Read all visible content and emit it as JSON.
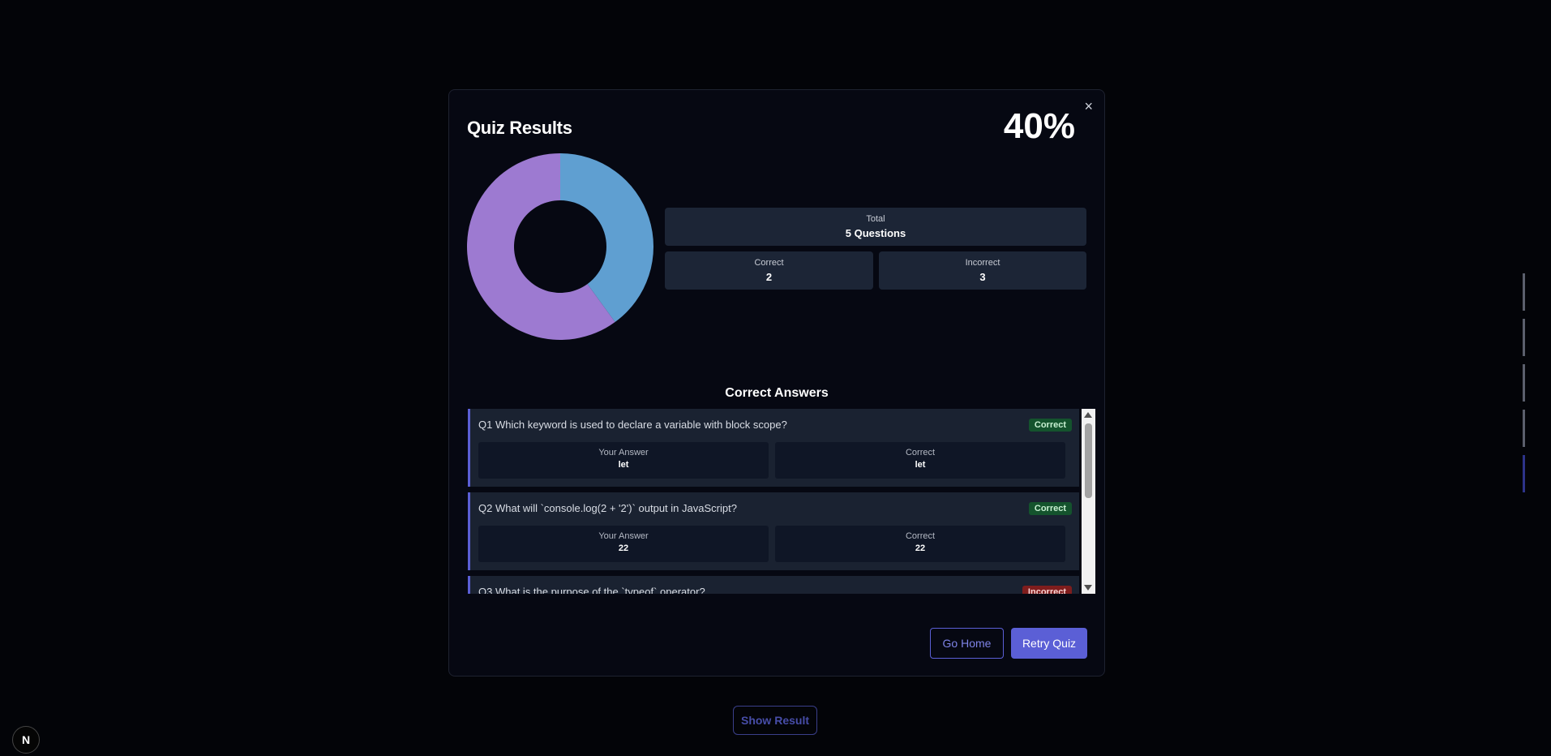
{
  "modal": {
    "title": "Quiz Results",
    "score": "40%",
    "close_glyph": "×"
  },
  "stats": {
    "total_label": "Total",
    "total_value": "5 Questions",
    "correct_label": "Correct",
    "correct_value": "2",
    "incorrect_label": "Incorrect",
    "incorrect_value": "3"
  },
  "chart_data": {
    "type": "pie",
    "slices": [
      {
        "value": 2,
        "color": "#5f9fd1"
      },
      {
        "value": 3,
        "color": "#9d7ad1"
      }
    ]
  },
  "answers": {
    "section_title": "Correct Answers",
    "your_answer_label": "Your Answer",
    "correct_label": "Correct",
    "items": [
      {
        "number": "Q1",
        "question": "Which keyword is used to declare a variable with block scope?",
        "status": "Correct",
        "your_answer": "let",
        "correct_answer": "let"
      },
      {
        "number": "Q2",
        "question": "What will `console.log(2 + '2')` output in JavaScript?",
        "status": "Correct",
        "your_answer": "22",
        "correct_answer": "22"
      },
      {
        "number": "Q3",
        "question": "What is the purpose of the `typeof` operator?",
        "status": "Incorrect",
        "your_answer": "",
        "correct_answer": ""
      }
    ]
  },
  "buttons": {
    "go_home": "Go Home",
    "retry": "Retry Quiz"
  },
  "page": {
    "show_result": "Show Result",
    "next_badge": "N"
  },
  "colors": {
    "accent": "#5b5fd6",
    "correct_badge": "#14532d",
    "incorrect_badge": "#7f1d1d"
  }
}
